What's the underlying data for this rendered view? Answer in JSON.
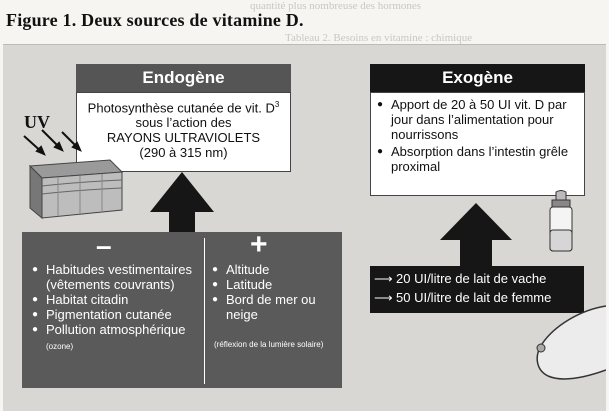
{
  "figure_title": "Figure 1. Deux sources de vitamine D.",
  "bleed_text": {
    "line1": "quantité plus nombreuse des hormones",
    "line2": "Tableau 2. Besoins en vitamine : chimique"
  },
  "endogene": {
    "title": "Endogène",
    "uv_label": "UV",
    "text_lines": [
      "Photosynthèse cutanée de vit. D",
      "sous l’action des",
      "RAYONS ULTRAVIOLETS",
      "(290 à 315 nm)"
    ],
    "superscript": "3"
  },
  "minus_factors": {
    "sign": "–",
    "items": [
      "Habitudes vestimentaires (vêtements couvrants)",
      "Habitat citadin",
      "Pigmentation cutanée",
      "Pollution atmosphérique"
    ],
    "pollution_note": "(ozone)"
  },
  "plus_factors": {
    "sign": "+",
    "items": [
      "Altitude",
      "Latitude",
      "Bord de mer ou neige"
    ],
    "note": "(réflexion de la lumière solaire)"
  },
  "exogene": {
    "title": "Exogène",
    "items": [
      "Apport de 20 à 50 UI vit. D par jour dans l’alimentation pour nourrissons",
      "Absorption dans l’intestin grêle proximal"
    ]
  },
  "milk": {
    "rows": [
      "20 UI/litre de lait de vache",
      "50 UI/litre de lait de femme"
    ]
  },
  "colors": {
    "dark_box": "#5a5a5a",
    "black_box": "#161616",
    "panel": "#d8d7d3"
  }
}
